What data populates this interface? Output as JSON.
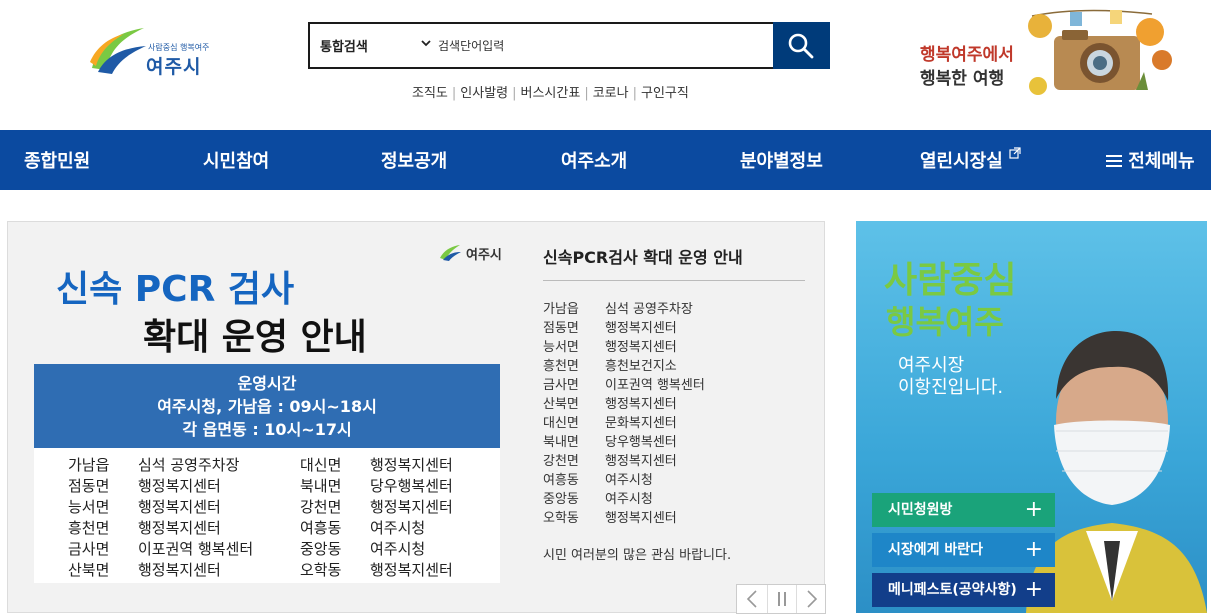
{
  "header": {
    "logo_small": "사람중심 행복여주",
    "logo_big": "여주시",
    "search": {
      "scope": "통합검색",
      "placeholder": "검색단어입력"
    },
    "quick_links": [
      "조직도",
      "인사발령",
      "버스시간표",
      "코로나",
      "구인구직"
    ],
    "banner": {
      "line1": "행복여주에서",
      "line2": "행복한 여행"
    }
  },
  "nav": {
    "items": [
      "종합민원",
      "시민참여",
      "정보공개",
      "여주소개",
      "분야별정보",
      "열린시장실",
      "전체메뉴"
    ]
  },
  "slide": {
    "poster": {
      "logo": "여주시",
      "title1": "신속 PCR 검사",
      "title2": "확대 운영 안내",
      "box_title": "운영시간",
      "box_line1": "여주시청, 가남읍 : 09시~18시",
      "box_line2": "각 읍면동 : 10시~17시",
      "left": [
        {
          "area": "가남읍",
          "place": "심석 공영주차장"
        },
        {
          "area": "점동면",
          "place": "행정복지센터"
        },
        {
          "area": "능서면",
          "place": "행정복지센터"
        },
        {
          "area": "흥천면",
          "place": "행정복지센터"
        },
        {
          "area": "금사면",
          "place": "이포권역 행복센터"
        },
        {
          "area": "산북면",
          "place": "행정복지센터"
        }
      ],
      "right": [
        {
          "area": "대신면",
          "place": "행정복지센터"
        },
        {
          "area": "북내면",
          "place": "당우행복센터"
        },
        {
          "area": "강천면",
          "place": "행정복지센터"
        },
        {
          "area": "여흥동",
          "place": "여주시청"
        },
        {
          "area": "중앙동",
          "place": "여주시청"
        },
        {
          "area": "오학동",
          "place": "행정복지센터"
        }
      ]
    },
    "info": {
      "title": "신속PCR검사 확대 운영 안내",
      "rows": [
        {
          "area": "가남읍",
          "place": "심석 공영주차장"
        },
        {
          "area": "점동면",
          "place": "행정복지센터"
        },
        {
          "area": "능서면",
          "place": "행정복지센터"
        },
        {
          "area": "흥천면",
          "place": "흥천보건지소"
        },
        {
          "area": "금사면",
          "place": "이포권역 행복센터"
        },
        {
          "area": "산북면",
          "place": "행정복지센터"
        },
        {
          "area": "대신면",
          "place": "문화복지센터"
        },
        {
          "area": "북내면",
          "place": "당우행복센터"
        },
        {
          "area": "강천면",
          "place": "행정복지센터"
        },
        {
          "area": "여흥동",
          "place": "여주시청"
        },
        {
          "area": "중앙동",
          "place": "여주시청"
        },
        {
          "area": "오학동",
          "place": "행정복지센터"
        }
      ],
      "footer": "시민 여러분의 많은 관심 바랍니다."
    }
  },
  "mayor": {
    "slogan1": "사람중심",
    "slogan2": "행복여주",
    "name1": "여주시장",
    "name2": "이항진입니다.",
    "buttons": [
      {
        "label": "시민청원방",
        "color": "#1aa37a"
      },
      {
        "label": "시장에게 바란다",
        "color": "#1e86c8"
      },
      {
        "label": "메니페스토(공약사항)",
        "color": "#123e8a"
      }
    ]
  }
}
